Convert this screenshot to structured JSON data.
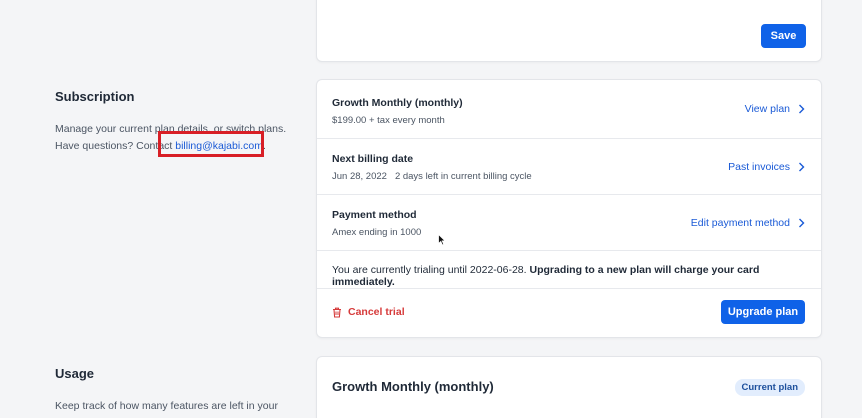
{
  "top_card": {
    "save_label": "Save"
  },
  "subscription": {
    "title": "Subscription",
    "desc_line1": "Manage your current plan details, or switch plans.",
    "desc_line2_prefix": "Have questions? Contact ",
    "email": "billing@kajabi.com",
    "desc_line2_suffix": ".",
    "plan": {
      "name": "Growth Monthly (monthly)",
      "price": "$199.00 + tax every month",
      "action": "View plan"
    },
    "billing": {
      "title": "Next billing date",
      "date": "Jun 28, 2022",
      "days_left": "2 days left in current billing cycle",
      "action": "Past invoices"
    },
    "payment": {
      "title": "Payment method",
      "card": "Amex ending in 1000",
      "action": "Edit payment method"
    },
    "trial": {
      "text": "You are currently trialing until 2022-06-28. ",
      "bold": "Upgrading to a new plan will charge your card immediately."
    },
    "cancel_label": "Cancel trial",
    "upgrade_label": "Upgrade plan"
  },
  "usage": {
    "title": "Usage",
    "desc": "Keep track of how many features are left in your",
    "plan_title": "Growth Monthly (monthly)",
    "badge": "Current plan"
  },
  "colors": {
    "primary": "#0f62e8",
    "link": "#1a5ad6",
    "danger": "#d63a3a",
    "highlight": "#d81f26"
  }
}
